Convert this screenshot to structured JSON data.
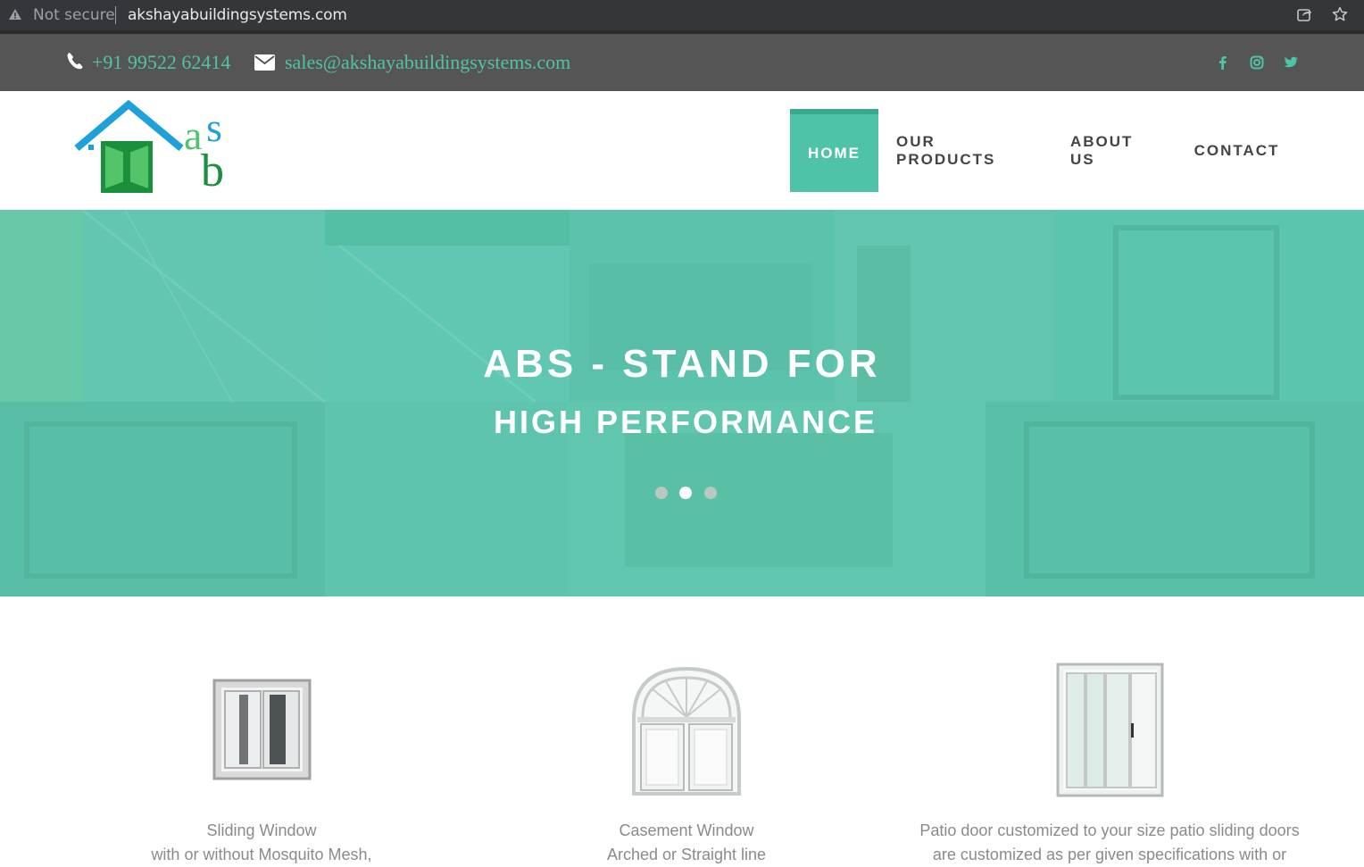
{
  "browser": {
    "security_label": "Not secure",
    "url": "akshayabuildingsystems.com"
  },
  "topbar": {
    "phone": "+91 99522 62414",
    "email": "sales@akshayabuildingsystems.com",
    "social": [
      "facebook-icon",
      "instagram-icon",
      "twitter-icon"
    ],
    "accent_color": "#4fc3a7"
  },
  "nav": {
    "items": [
      {
        "label": "HOME",
        "active": true
      },
      {
        "label": "OUR PRODUCTS",
        "active": false
      },
      {
        "label": "ABOUT US",
        "active": false
      },
      {
        "label": "CONTACT",
        "active": false
      }
    ]
  },
  "hero": {
    "title": "ABS - STAND FOR",
    "subtitle": "HIGH PERFORMANCE",
    "slides": 3,
    "active_slide": 2,
    "overlay_color": "#5ec8b0"
  },
  "products": [
    {
      "line1": "Sliding Window",
      "line2": "with or without Mosquito Mesh,"
    },
    {
      "line1": "Casement Window",
      "line2": "Arched or Straight line"
    },
    {
      "line1": "Patio door customized to your size patio sliding doors",
      "line2": "are customized as per given specifications with or"
    }
  ]
}
